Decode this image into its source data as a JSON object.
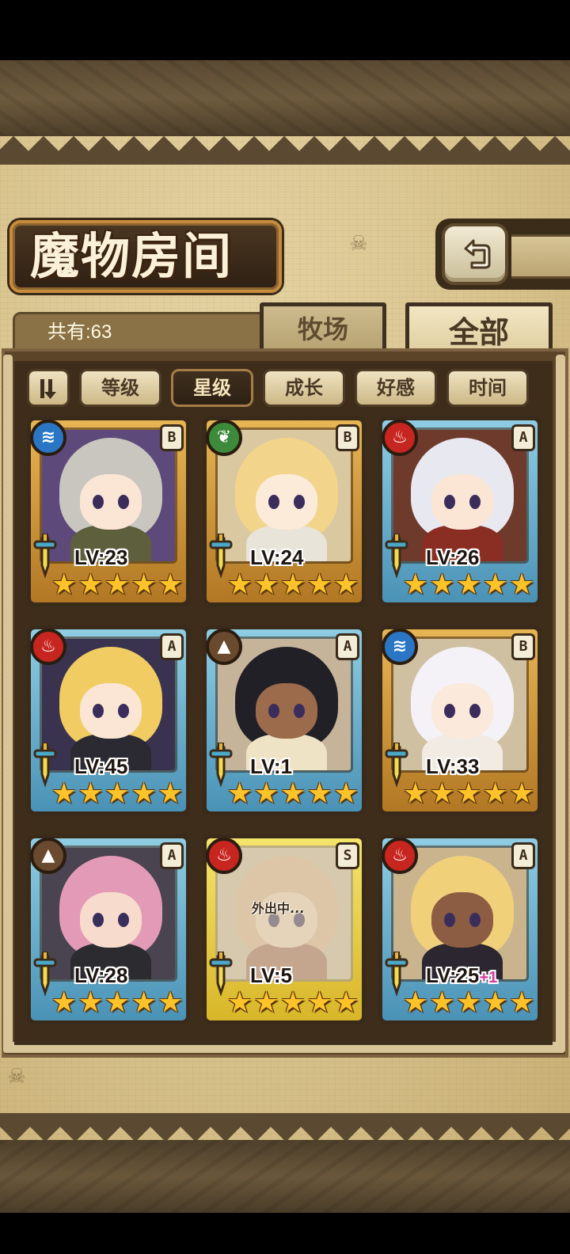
{
  "screen": {
    "title": "魔物房间",
    "total_count": "共有:63"
  },
  "tabs": [
    {
      "label": "牧场",
      "selected": false
    },
    {
      "label": "全部",
      "selected": true
    }
  ],
  "sort_filters": [
    {
      "label": "等级",
      "active": false
    },
    {
      "label": "星级",
      "active": true
    },
    {
      "label": "成长",
      "active": false
    },
    {
      "label": "好感",
      "active": false
    },
    {
      "label": "时间",
      "active": false
    }
  ],
  "monsters": [
    {
      "element": "water",
      "rank": "B",
      "level": "LV:23",
      "stars": 5,
      "frame": "gold",
      "palette": {
        "hair": "#c9c6c0",
        "face": "#fbe6d5",
        "body": "#5d5f3d",
        "bg": "#5e4a7a"
      }
    },
    {
      "element": "nature",
      "rank": "B",
      "level": "LV:24",
      "stars": 5,
      "frame": "gold",
      "palette": {
        "hair": "#f2d48a",
        "face": "#fcebd8",
        "body": "#e8e4da",
        "bg": "#d9c8a0"
      }
    },
    {
      "element": "fire",
      "rank": "A",
      "level": "LV:26",
      "stars": 5,
      "frame": "blue",
      "palette": {
        "hair": "#e8e8f0",
        "face": "#fbe6d5",
        "body": "#8a2d22",
        "bg": "#6e3a2c"
      }
    },
    {
      "element": "fire",
      "rank": "A",
      "level": "LV:45",
      "stars": 5,
      "frame": "blue",
      "palette": {
        "hair": "#f0cc62",
        "face": "#fbe6d5",
        "body": "#2b2a33",
        "bg": "#3a3350"
      }
    },
    {
      "element": "earth",
      "rank": "A",
      "level": "LV:1",
      "stars": 5,
      "frame": "blue",
      "palette": {
        "hair": "#222027",
        "face": "#9b6b4c",
        "body": "#efe3c5",
        "bg": "#c6b49a"
      }
    },
    {
      "element": "water",
      "rank": "B",
      "level": "LV:33",
      "stars": 5,
      "frame": "gold",
      "palette": {
        "hair": "#f4f2f6",
        "face": "#fbe9dc",
        "body": "#f1ebe3",
        "bg": "#cfc0a2"
      }
    },
    {
      "element": "earth",
      "rank": "A",
      "level": "LV:28",
      "stars": 5,
      "frame": "blue",
      "palette": {
        "hair": "#e39ab6",
        "face": "#f7dccd",
        "body": "#2c2c30",
        "bg": "#4a4350"
      }
    },
    {
      "element": "fire",
      "rank": "S",
      "level": "LV:5",
      "stars": 5,
      "frame": "yellow",
      "status": "外出中...",
      "palette": {
        "hair": "#d7b28d",
        "face": "#e9cfb5",
        "body": "#a06a55",
        "bg": "#cbb89a"
      }
    },
    {
      "element": "fire",
      "rank": "A",
      "level": "LV:25",
      "level_bonus": "+1",
      "stars": 5,
      "frame": "blue",
      "palette": {
        "hair": "#f1d07a",
        "face": "#8c5d42",
        "body": "#2b2630",
        "bg": "#c9b48e"
      }
    }
  ]
}
